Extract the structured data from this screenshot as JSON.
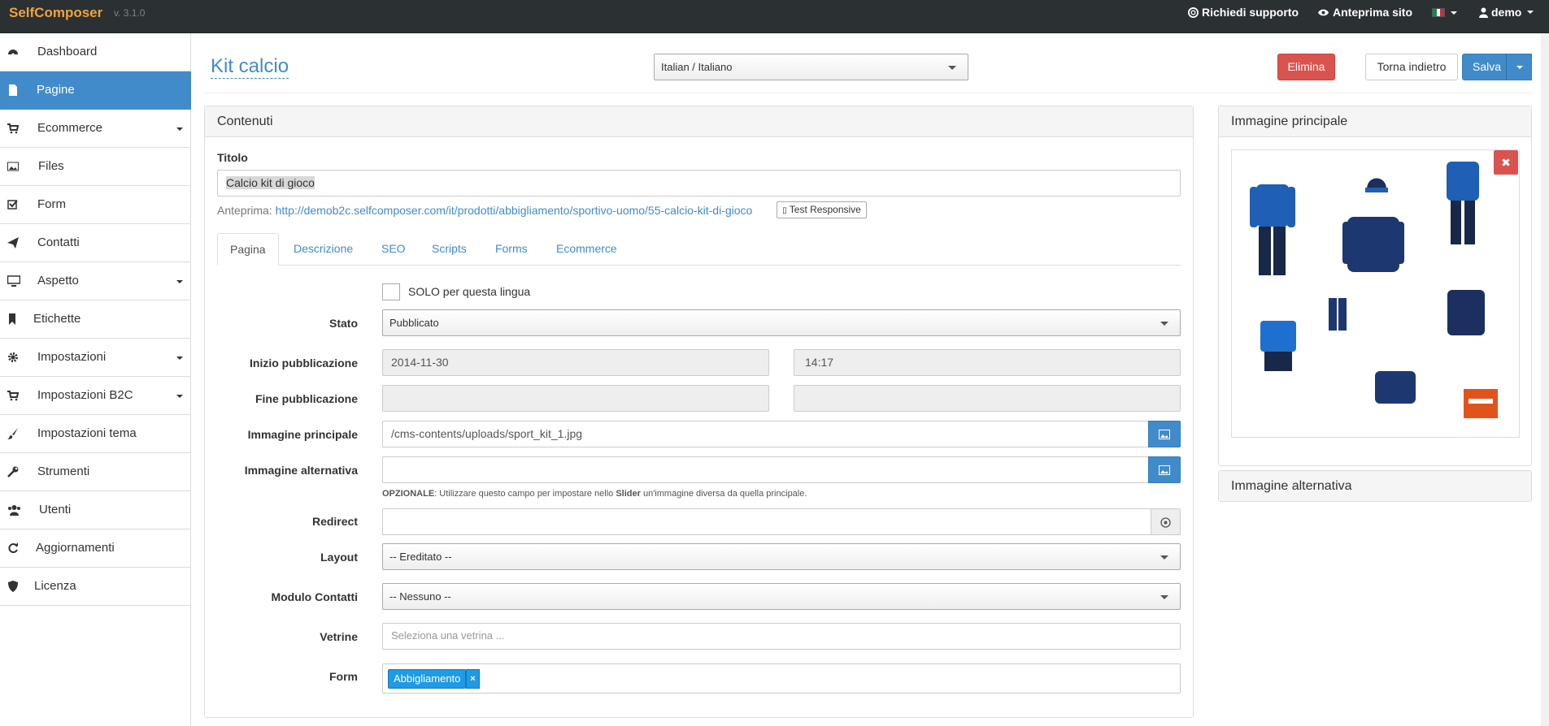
{
  "navbar": {
    "brand": "SelfComposer",
    "version": "v. 3.1.0",
    "support": "Richiedi supporto",
    "preview_site": "Anteprima sito",
    "user": "demo"
  },
  "sidebar": {
    "items": [
      {
        "label": "Dashboard",
        "icon": "dashboard-icon"
      },
      {
        "label": "Pagine",
        "icon": "file-icon",
        "active": true
      },
      {
        "label": "Ecommerce",
        "icon": "cart-icon",
        "caret": true
      },
      {
        "label": "Files",
        "icon": "picture-icon"
      },
      {
        "label": "Form",
        "icon": "checkbox-icon"
      },
      {
        "label": "Contatti",
        "icon": "send-icon"
      },
      {
        "label": "Aspetto",
        "icon": "monitor-icon",
        "caret": true
      },
      {
        "label": "Etichette",
        "icon": "bookmark-icon"
      },
      {
        "label": "Impostazioni",
        "icon": "gear-icon",
        "caret": true
      },
      {
        "label": "Impostazioni B2C",
        "icon": "cart-icon",
        "caret": true
      },
      {
        "label": "Impostazioni tema",
        "icon": "brush-icon"
      },
      {
        "label": "Strumenti",
        "icon": "wrench-icon"
      },
      {
        "label": "Utenti",
        "icon": "users-icon"
      },
      {
        "label": "Aggiornamenti",
        "icon": "refresh-icon"
      },
      {
        "label": "Licenza",
        "icon": "shield-icon"
      }
    ]
  },
  "header": {
    "title": "Kit calcio",
    "language": "Italian / Italiano",
    "delete": "Elimina",
    "back": "Torna indietro",
    "save": "Salva"
  },
  "contenuti": {
    "heading": "Contenuti",
    "title_label": "Titolo",
    "title_value": "Calcio kit di gioco",
    "preview_label": "Anteprima:",
    "preview_url": "http://demob2c.selfcomposer.com/it/prodotti/abbigliamento/sportivo-uomo/55-calcio-kit-di-gioco",
    "test_responsive": "Test Responsive",
    "tabs": [
      "Pagina",
      "Descrizione",
      "SEO",
      "Scripts",
      "Forms",
      "Ecommerce"
    ],
    "only_language": "SOLO per questa lingua",
    "fields": {
      "stato_label": "Stato",
      "stato_value": "Pubblicato",
      "inizio_label": "Inizio pubblicazione",
      "inizio_date": "2014-11-30",
      "inizio_time": "14:17",
      "fine_label": "Fine pubblicazione",
      "img_label": "Immagine principale",
      "img_value": "/cms-contents/uploads/sport_kit_1.jpg",
      "img_alt_label": "Immagine alternativa",
      "help_bold": "OPZIONALE",
      "help_text": ": Utilizzare questo campo per impostare nello ",
      "help_slider": "Slider",
      "help_end": " un'immagine diversa da quella principale.",
      "redirect_label": "Redirect",
      "layout_label": "Layout",
      "layout_value": "-- Ereditato --",
      "modulo_label": "Modulo Contatti",
      "modulo_value": "-- Nessuno --",
      "vetrine_label": "Vetrine",
      "vetrine_placeholder": "Seleziona una vetrina ...",
      "form_label": "Form",
      "form_tag": "Abbigliamento"
    }
  },
  "right": {
    "main_image_heading": "Immagine principale",
    "alt_image_heading": "Immagine alternativa"
  },
  "colors": {
    "primary": "#428bca",
    "danger": "#d9534f",
    "brand": "#f0a33a",
    "navbar": "#2b3033"
  }
}
